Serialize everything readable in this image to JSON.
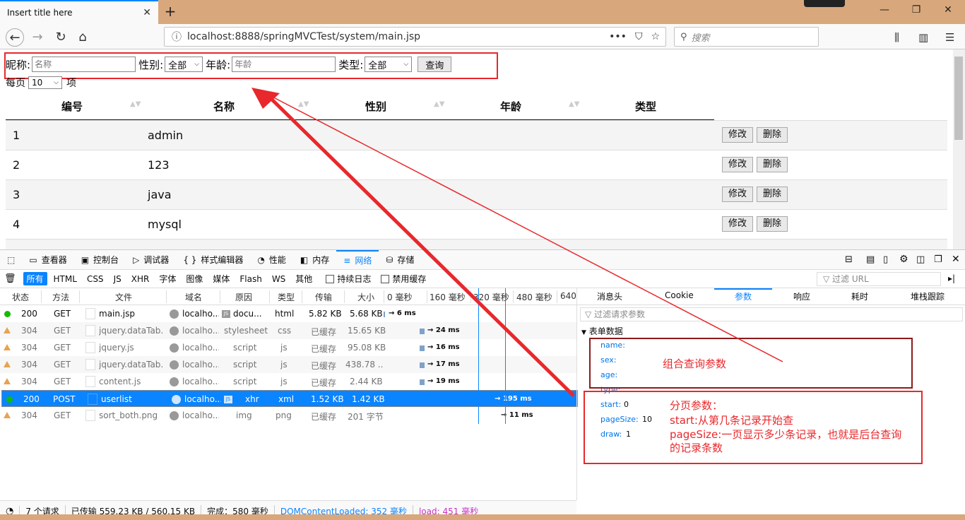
{
  "browser": {
    "tab_title": "Insert title here",
    "tab_close": "✕",
    "new_tab": "+",
    "url": "localhost:8888/springMVCTest/system/main.jsp",
    "search_placeholder": "搜索",
    "page_actions": "•••"
  },
  "filters": {
    "nickname_label": "昵称:",
    "nickname_placeholder": "名称",
    "gender_label": "性别:",
    "gender_value": "全部",
    "age_label": "年龄:",
    "age_placeholder": "年龄",
    "type_label": "类型:",
    "type_value": "全部",
    "query_button": "查询"
  },
  "pagination": {
    "prefix": "每页",
    "size": "10",
    "suffix": "项"
  },
  "table": {
    "headers": [
      "编号",
      "名称",
      "性别",
      "年龄",
      "类型"
    ],
    "rows": [
      {
        "id": "1",
        "name": "admin"
      },
      {
        "id": "2",
        "name": "123"
      },
      {
        "id": "3",
        "name": "java"
      },
      {
        "id": "4",
        "name": "mysql"
      }
    ],
    "edit_label": "修改",
    "delete_label": "删除"
  },
  "devtools": {
    "tabs": [
      "查看器",
      "控制台",
      "调试器",
      "样式编辑器",
      "性能",
      "内存",
      "网络",
      "存储"
    ],
    "filter_buttons": [
      "所有",
      "HTML",
      "CSS",
      "JS",
      "XHR",
      "字体",
      "图像",
      "媒体",
      "Flash",
      "WS",
      "其他"
    ],
    "persist_logs": "持续日志",
    "disable_cache": "禁用缓存",
    "url_filter": "过滤 URL",
    "columns": [
      "状态",
      "方法",
      "文件",
      "域名",
      "原因",
      "类型",
      "传输",
      "大小"
    ],
    "timeline_ticks": [
      "0 毫秒",
      "160 毫秒",
      "320 毫秒",
      "480 毫秒",
      "640"
    ],
    "requests": [
      {
        "status": "200",
        "method": "GET",
        "file": "main.jsp",
        "domain": "localho...",
        "cause": "docu...",
        "type": "html",
        "transferred": "5.82 KB",
        "size": "5.68 KB",
        "time": "→ 6 ms"
      },
      {
        "status": "304",
        "method": "GET",
        "file": "jquery.dataTab...",
        "domain": "localho...",
        "cause": "stylesheet",
        "type": "css",
        "transferred": "已缓存",
        "size": "15.65 KB",
        "time": "→ 24 ms"
      },
      {
        "status": "304",
        "method": "GET",
        "file": "jquery.js",
        "domain": "localho...",
        "cause": "script",
        "type": "js",
        "transferred": "已缓存",
        "size": "95.08 KB",
        "time": "→ 16 ms"
      },
      {
        "status": "304",
        "method": "GET",
        "file": "jquery.dataTab...",
        "domain": "localho...",
        "cause": "script",
        "type": "js",
        "transferred": "已缓存",
        "size": "438.78 ...",
        "time": "→ 17 ms"
      },
      {
        "status": "304",
        "method": "GET",
        "file": "content.js",
        "domain": "localho...",
        "cause": "script",
        "type": "js",
        "transferred": "已缓存",
        "size": "2.44 KB",
        "time": "→ 19 ms"
      },
      {
        "status": "200",
        "method": "POST",
        "file": "userlist",
        "domain": "localho...",
        "cause": "xhr",
        "type": "xml",
        "transferred": "1.52 KB",
        "size": "1.42 KB",
        "time": "→ 195 ms"
      },
      {
        "status": "304",
        "method": "GET",
        "file": "sort_both.png",
        "domain": "localho...",
        "cause": "img",
        "type": "png",
        "transferred": "已缓存",
        "size": "201 字节",
        "time": "→ 11 ms"
      }
    ],
    "side_tabs": [
      "消息头",
      "Cookie",
      "参数",
      "响应",
      "耗时",
      "堆栈跟踪"
    ],
    "param_filter": "过滤请求参数",
    "form_section": "表单数据",
    "params": [
      {
        "key": "name:",
        "value": ""
      },
      {
        "key": "sex:",
        "value": ""
      },
      {
        "key": "age:",
        "value": ""
      },
      {
        "key": "type:",
        "value": ""
      },
      {
        "key": "start:",
        "value": "0"
      },
      {
        "key": "pageSize:",
        "value": "10"
      },
      {
        "key": "draw:",
        "value": "1"
      }
    ],
    "status": {
      "requests": "7 个请求",
      "transferred": "已传输 559.23 KB / 560.15 KB",
      "finish": "完成：580 毫秒",
      "dcl": "DOMContentLoaded: 352 毫秒",
      "load": "load: 451 毫秒"
    }
  },
  "annotations": {
    "combo": "组合查询参数",
    "paging_title": "分页参数：",
    "paging_start": "start:从第几条记录开始查",
    "paging_size_1": "pageSize:一页显示多少条记录，也就是后台查询",
    "paging_size_2": "的记录条数"
  },
  "colors": {
    "accent": "#0a84ff",
    "annotation_red": "#e8282c",
    "titlebar": "#d8a87c"
  }
}
